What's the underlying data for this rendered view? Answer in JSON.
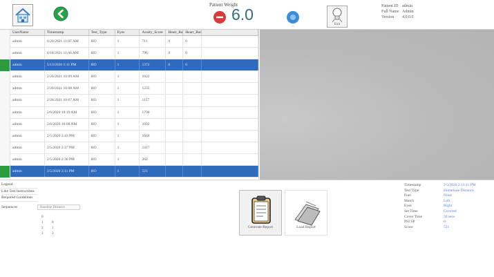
{
  "header": {
    "patient_weight_label": "Patient Weight",
    "weight_value": "6.0",
    "exit_label": "Exit",
    "patient_info": [
      {
        "key": "Patient ID",
        "value": "admin"
      },
      {
        "key": "Full Name",
        "value": "Admin"
      },
      {
        "key": "Version",
        "value": "4.0.0.0"
      }
    ]
  },
  "grid": {
    "columns": [
      "UserName",
      "Timestamp",
      "Test_Type",
      "Eyes",
      "Acuity_Score",
      "Heart_Rate",
      "Heart_Rate"
    ],
    "rows": [
      [
        "admin",
        "6/20/2021 11:07 AM",
        "HO",
        "1",
        "711",
        "0",
        "0"
      ],
      [
        "admin",
        "6/18/2021 11:06 AM",
        "HO",
        "1",
        "796",
        "0",
        "0"
      ],
      [
        "admin",
        "5/13/2020 1:11 PM",
        "HO",
        "1",
        "1372",
        "0",
        "0"
      ],
      [
        "admin",
        "2/26/2021 10:09 AM",
        "HO",
        "1",
        "1022",
        "",
        ""
      ],
      [
        "admin",
        "2/26/2021 10:08 AM",
        "HO",
        "1",
        "1235",
        "",
        ""
      ],
      [
        "admin",
        "2/26/2021 10:07 AM",
        "HO",
        "1",
        "1157",
        "",
        ""
      ],
      [
        "admin",
        "2/6/2020 10:19 AM",
        "HO",
        "1",
        "1790",
        "",
        ""
      ],
      [
        "admin",
        "2/6/2020 10:08 AM",
        "HO",
        "1",
        "1092",
        "",
        ""
      ],
      [
        "admin",
        "2/5/2020 2:43 PM",
        "HO",
        "1",
        "1664",
        "",
        ""
      ],
      [
        "admin",
        "2/5/2020 2:37 PM",
        "HO",
        "1",
        "1417",
        "",
        ""
      ],
      [
        "admin",
        "2/5/2020 2:36 PM",
        "HO",
        "1",
        "262",
        "",
        ""
      ],
      [
        "admin",
        "2/5/2020 2:11 PM",
        "HO",
        "1",
        "521",
        "",
        ""
      ]
    ],
    "selected_rows": [
      2,
      11
    ]
  },
  "legend": {
    "items": [
      "Legend",
      "Like Test Instructions",
      "Required Guidelines"
    ]
  },
  "sequences": {
    "label": "Sequences",
    "dropdown_value": "Baseline Distance",
    "rows": [
      {
        "a": "0",
        "b": ""
      },
      {
        "a": "1",
        "b": "0"
      },
      {
        "a": "2",
        "b": "1"
      },
      {
        "a": "3",
        "b": "2"
      }
    ]
  },
  "buttons": {
    "generate_report": "Generate Report",
    "load_report": "Load Report"
  },
  "details": [
    {
      "key": "Timestamp",
      "value": "2/5/2020 2:11:11 PM"
    },
    {
      "key": "Test Type",
      "value": "Homebase Distance"
    },
    {
      "key": "Fuel",
      "value": "None"
    },
    {
      "key": "Match",
      "value": "Left"
    },
    {
      "key": "Eyes",
      "value": "Right"
    },
    {
      "key": "Set Time",
      "value": "Covered"
    },
    {
      "key": "Cover Time",
      "value": "30 secs"
    },
    {
      "key": "PSI SP",
      "value": "0"
    },
    {
      "key": "Score",
      "value": "521"
    }
  ],
  "colors": {
    "selected_row": "#2f6bbd",
    "row_marker": "#2c9b3c",
    "weight_text": "#2f6e7a",
    "minus_button": "#d63a3a",
    "plus_button": "#3a8ed8",
    "back_button": "#2aa14a"
  },
  "icons": {
    "home": "home-icon",
    "back": "arrow-left-icon",
    "minus": "minus-icon",
    "plus": "plus-icon",
    "exit": "lightbulb-icon",
    "generate": "clipboard-icon",
    "load": "folder-icon"
  }
}
